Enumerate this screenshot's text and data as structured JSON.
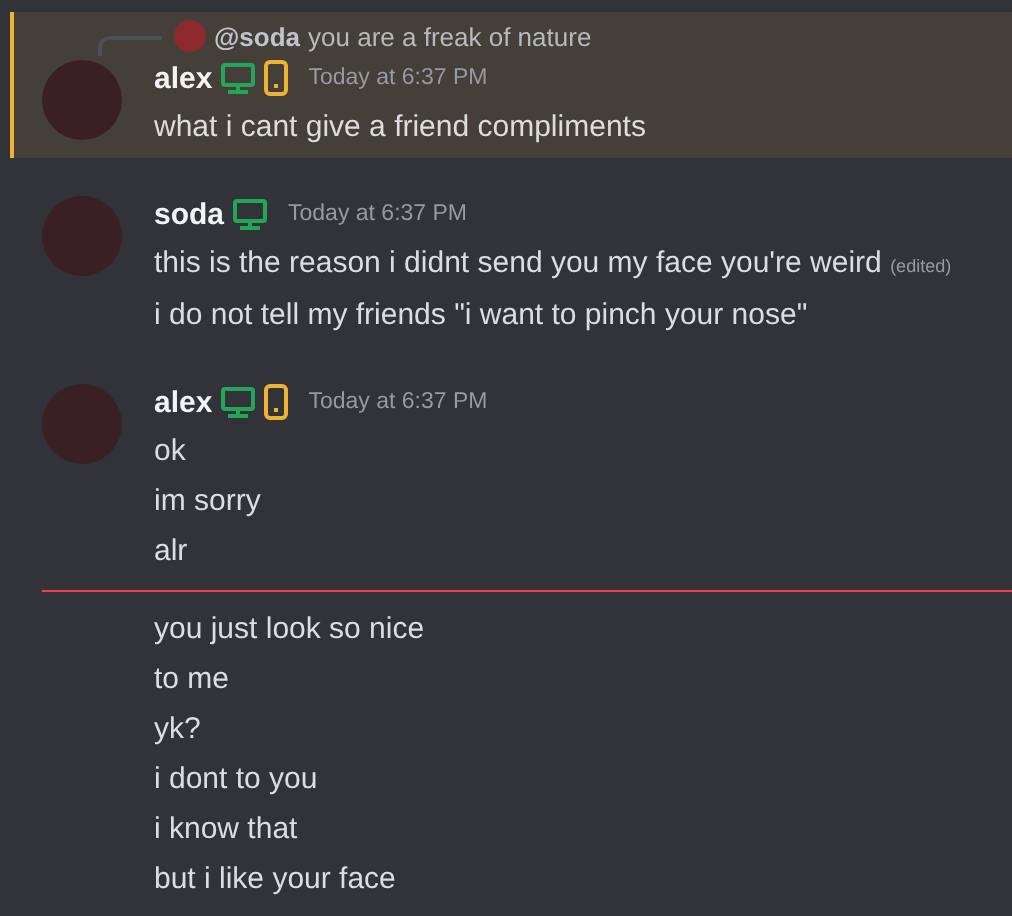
{
  "messages": [
    {
      "highlighted": true,
      "reply": {
        "mention": "@soda",
        "text": "you are a freak of nature"
      },
      "author": "alex",
      "badges": [
        {
          "kind": "desktop"
        },
        {
          "kind": "mobile"
        }
      ],
      "timestamp": "Today at 6:37 PM",
      "lines": [
        {
          "kind": "text",
          "text": "what i cant give a friend compliments"
        }
      ]
    },
    {
      "highlighted": false,
      "author": "soda",
      "badges": [
        {
          "kind": "desktop"
        }
      ],
      "timestamp": "Today at 6:37 PM",
      "lines": [
        {
          "kind": "text",
          "text": "this is the reason i didnt send you my face you're weird",
          "edited": "(edited)"
        },
        {
          "kind": "text",
          "text": "i do not tell my friends \"i want to pinch your nose\""
        }
      ]
    },
    {
      "highlighted": false,
      "author": "alex",
      "badges": [
        {
          "kind": "desktop"
        },
        {
          "kind": "mobile"
        }
      ],
      "timestamp": "Today at 6:37 PM",
      "lines": [
        {
          "kind": "text",
          "text": "ok"
        },
        {
          "kind": "text",
          "text": "im sorry"
        },
        {
          "kind": "text",
          "text": "alr"
        },
        {
          "kind": "divider"
        },
        {
          "kind": "text",
          "text": "you just look so nice"
        },
        {
          "kind": "text",
          "text": "to me"
        },
        {
          "kind": "text",
          "text": "yk?"
        },
        {
          "kind": "text",
          "text": "i dont to you"
        },
        {
          "kind": "text",
          "text": "i know that"
        },
        {
          "kind": "text",
          "text": "but i like your face"
        }
      ]
    }
  ]
}
